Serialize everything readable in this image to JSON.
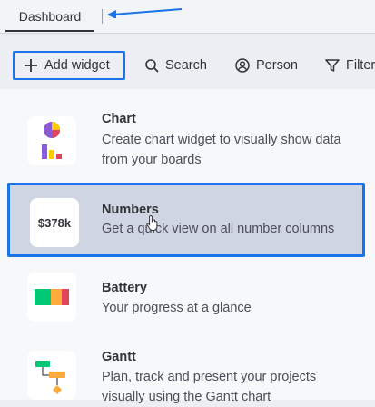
{
  "tabs": {
    "dashboard": "Dashboard"
  },
  "toolbar": {
    "add_widget": "Add widget",
    "search": "Search",
    "person": "Person",
    "filter": "Filter"
  },
  "widgets": [
    {
      "title": "Chart",
      "desc_line1": "Create chart widget to visually show data",
      "desc_line2": "from your boards",
      "icon": "chart-icon"
    },
    {
      "title": "Numbers",
      "desc": "Get a quick view on all number columns",
      "thumb_value": "$378k",
      "icon": "numbers-icon"
    },
    {
      "title": "Battery",
      "desc": "Your progress at a glance",
      "icon": "battery-icon"
    },
    {
      "title": "Gantt",
      "desc_line1": "Plan, track and present your projects",
      "desc_line2": "visually using the Gantt chart",
      "icon": "gantt-icon"
    }
  ],
  "colors": {
    "highlight_border": "#1a73e8",
    "selected_bg": "#cfd5e2"
  }
}
